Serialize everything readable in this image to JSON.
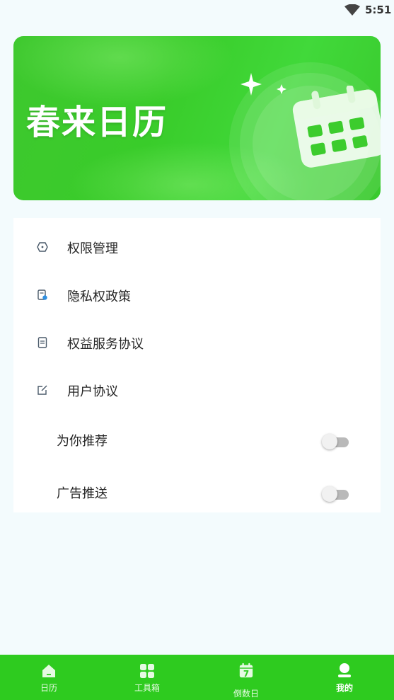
{
  "status": {
    "time": "5:51",
    "wifi_icon": "wifi-icon"
  },
  "banner": {
    "title": "春来日历",
    "icon": "calendar-icon"
  },
  "menu": {
    "items": [
      {
        "label": "权限管理",
        "icon": "permission-icon"
      },
      {
        "label": "隐私权政策",
        "icon": "privacy-doc-icon"
      },
      {
        "label": "权益服务协议",
        "icon": "document-icon"
      },
      {
        "label": "用户协议",
        "icon": "edit-icon"
      }
    ],
    "toggles": [
      {
        "label": "为你推荐",
        "on": false
      },
      {
        "label": "广告推送",
        "on": false
      }
    ]
  },
  "tabbar": {
    "tabs": [
      {
        "label": "日历",
        "icon": "home-icon",
        "active": false
      },
      {
        "label": "工具箱",
        "icon": "grid-icon",
        "active": false
      },
      {
        "label": "倒数日",
        "icon": "countdown-calendar-icon",
        "badge": "7",
        "active": false
      },
      {
        "label": "我的",
        "icon": "user-icon",
        "active": true
      }
    ]
  },
  "colors": {
    "accent": "#2ecb1f",
    "background": "#f3fbfd",
    "toggle_off": "#b9b9b9"
  }
}
